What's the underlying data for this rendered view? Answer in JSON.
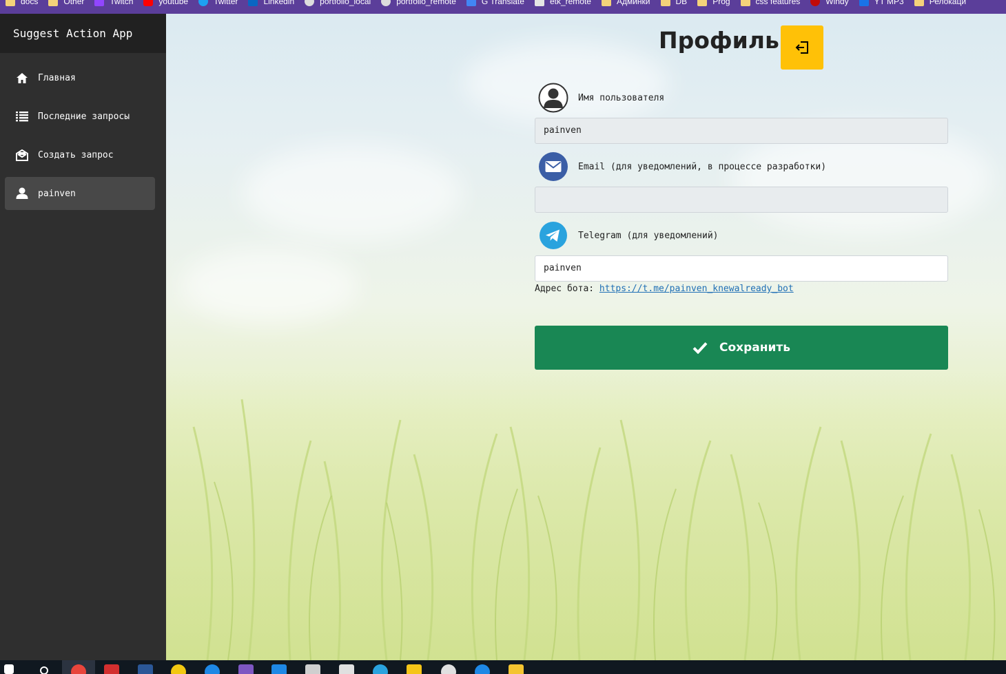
{
  "bookmarks": [
    {
      "label": "docs",
      "icon": "folder"
    },
    {
      "label": "Other",
      "icon": "folder"
    },
    {
      "label": "Twitch",
      "icon": "twitch"
    },
    {
      "label": "youtube",
      "icon": "yt"
    },
    {
      "label": "Twitter",
      "icon": "tw"
    },
    {
      "label": "Linkedin",
      "icon": "li"
    },
    {
      "label": "portfolio_local",
      "icon": "globe"
    },
    {
      "label": "portfolio_remote",
      "icon": "globe"
    },
    {
      "label": "G Translate",
      "icon": "gt"
    },
    {
      "label": "etk_remote",
      "icon": "etk"
    },
    {
      "label": "Админки",
      "icon": "folder"
    },
    {
      "label": "DB",
      "icon": "folder"
    },
    {
      "label": "Prog",
      "icon": "folder"
    },
    {
      "label": "css features",
      "icon": "folder"
    },
    {
      "label": "Windy",
      "icon": "windy"
    },
    {
      "label": "YT MP3",
      "icon": "play"
    },
    {
      "label": "Релокаци",
      "icon": "folder"
    }
  ],
  "sidebar": {
    "brand": "Suggest Action App",
    "items": [
      {
        "label": "Главная",
        "icon": "home-icon",
        "active": false
      },
      {
        "label": "Последние запросы",
        "icon": "list-icon",
        "active": false
      },
      {
        "label": "Создать запрос",
        "icon": "envelope-open-icon",
        "active": false
      },
      {
        "label": "painven",
        "icon": "user-icon",
        "active": true
      }
    ]
  },
  "profile": {
    "title": "Профиль",
    "username_label": "Имя пользователя",
    "username_value": "painven",
    "email_label": "Email (для уведомлений, в процессе разработки)",
    "email_value": "",
    "telegram_label": "Telegram (для уведомлений)",
    "telegram_value": "painven",
    "bot_prefix": "Адрес бота:",
    "bot_link": "https://t.me/painven_knewalready_bot",
    "save_label": "Сохранить"
  },
  "colors": {
    "sidebar_bg": "#2f2f2f",
    "brand_bg": "#212121",
    "logout_button": "#ffc107",
    "save_button": "#198754",
    "link": "#1f6fb5",
    "bookmarks_bg": "#5b3e9a"
  }
}
